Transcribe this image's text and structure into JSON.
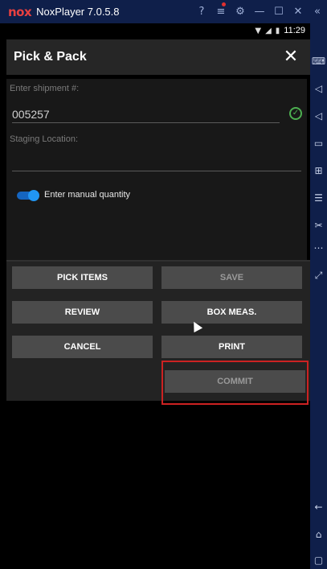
{
  "titlebar": {
    "logo": "nox",
    "app_name": "NoxPlayer 7.0.5.8",
    "icons": [
      "help-icon",
      "menu-icon",
      "settings-icon",
      "minimize-icon",
      "maximize-icon",
      "close-window-icon",
      "collapse-icon"
    ]
  },
  "statusbar": {
    "time": "11:29",
    "icons": [
      "wifi-icon",
      "signal-icon",
      "battery-icon"
    ]
  },
  "appbar": {
    "title": "Pick & Pack",
    "close_glyph": "✕"
  },
  "form": {
    "shipment_label": "Enter shipment #:",
    "shipment_value": "005257",
    "staging_label": "Staging Location:",
    "staging_value": "",
    "manual_qty_label": "Enter manual quantity",
    "manual_qty_on": true
  },
  "buttons": {
    "pick_items": "PICK ITEMS",
    "save": "SAVE",
    "review": "REVIEW",
    "box_meas": "BOX MEAS.",
    "cancel": "CANCEL",
    "print": "PRINT",
    "commit": "COMMIT"
  },
  "side_toolbar_icons": [
    "keyboard-icon",
    "volume-up-icon",
    "volume-down-icon",
    "screen-icon",
    "screenshot-icon",
    "stack-icon",
    "scissors-icon",
    "more-icon",
    "fullscreen-icon",
    "back-icon",
    "home-icon",
    "recent-apps-icon"
  ],
  "colors": {
    "emulator_frame": "#0f1f4a",
    "appbar": "#262626",
    "button": "#4b4b4b",
    "toggle_on": "#2196f3",
    "valid_check": "#4caf50",
    "highlight": "#cc2222"
  }
}
